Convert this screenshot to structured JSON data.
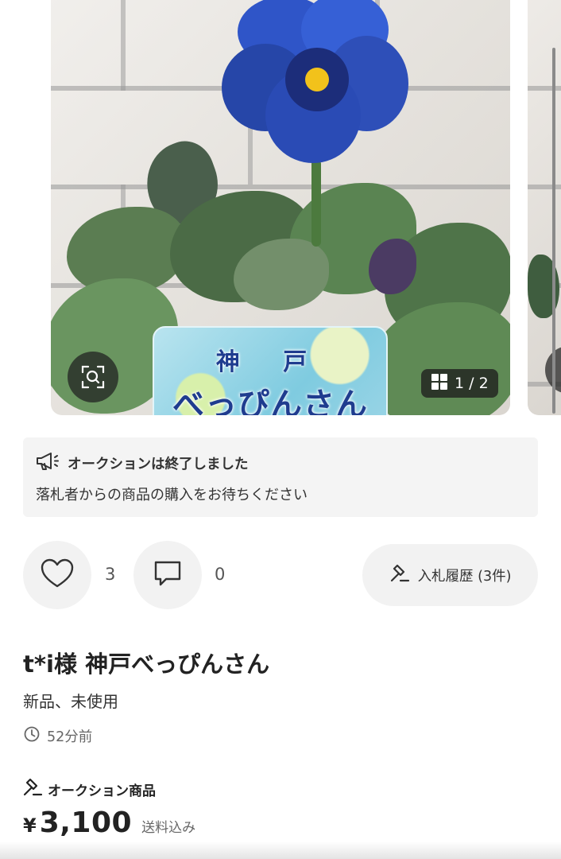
{
  "carousel": {
    "label_line1": "神 戸",
    "label_line2": "べっぴんさん",
    "counter": "1 / 2",
    "icons": {
      "zoom": "scan-search-icon",
      "gallery": "grid-icon"
    }
  },
  "notice": {
    "icon": "megaphone-icon",
    "title": "オークションは終了しました",
    "message": "落札者からの商品の購入をお待ちください"
  },
  "actions": {
    "likes_count": "3",
    "comments_count": "0",
    "bid_history_label": "入札履歴 (3件)"
  },
  "item": {
    "title": "t*i様 神戸べっぴんさん",
    "condition": "新品、未使用",
    "posted": "52分前",
    "auction_label": "オークション商品",
    "currency": "¥",
    "price": "3,100",
    "shipping": "送料込み"
  },
  "colors": {
    "notice_bg": "#f4f4f4",
    "button_bg": "#f2f2f2",
    "text": "#222222",
    "muted": "#666666"
  }
}
